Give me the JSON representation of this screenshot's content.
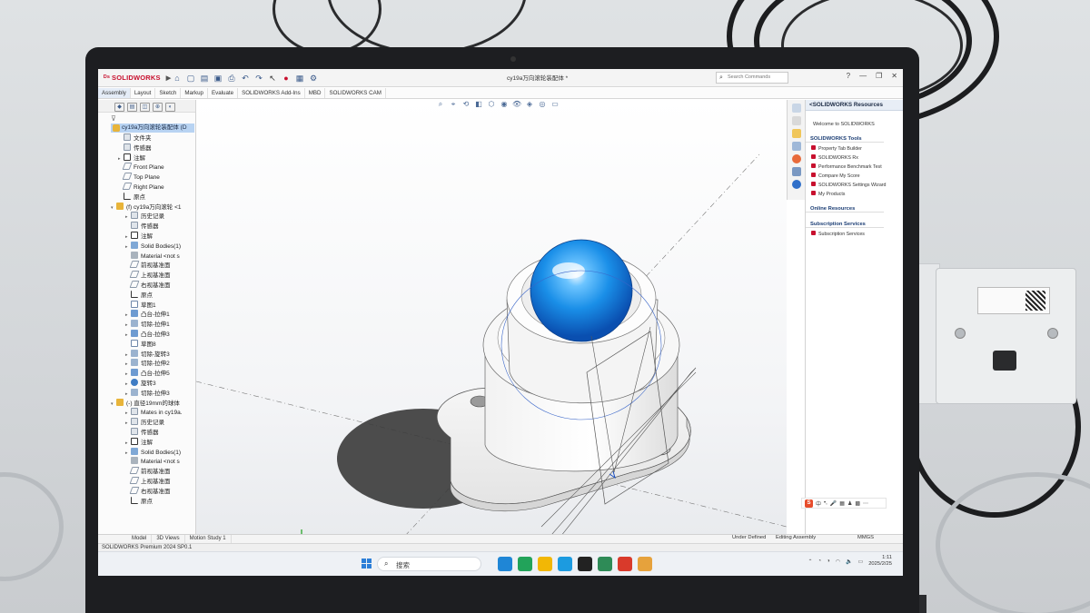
{
  "app": {
    "brand": "SOLIDWORKS",
    "document_title": "cy19a万向滚轮装配体 *",
    "search_placeholder": "Search Commands",
    "window_controls": [
      "?",
      "—",
      "❐",
      "✕"
    ]
  },
  "command_tabs": [
    {
      "label": "Assembly",
      "active": true
    },
    {
      "label": "Layout",
      "active": false
    },
    {
      "label": "Sketch",
      "active": false
    },
    {
      "label": "Markup",
      "active": false
    },
    {
      "label": "Evaluate",
      "active": false
    },
    {
      "label": "SOLIDWORKS Add-Ins",
      "active": false
    },
    {
      "label": "MBD",
      "active": false
    },
    {
      "label": "SOLIDWORKS CAM",
      "active": false
    }
  ],
  "feature_tree": {
    "root": "cy19a万向滚轮装配体 (D",
    "items": [
      {
        "label": "文件夹",
        "icon": "folder-icon",
        "indent": 1,
        "expander": "",
        "kind": "gen"
      },
      {
        "label": "传感器",
        "icon": "sensor-icon",
        "indent": 1,
        "expander": "",
        "kind": "gen"
      },
      {
        "label": "注解",
        "icon": "annotation-icon",
        "indent": 1,
        "expander": "▸",
        "kind": "ann"
      },
      {
        "label": "Front Plane",
        "icon": "plane-icon",
        "indent": 1,
        "expander": "",
        "kind": "plane"
      },
      {
        "label": "Top Plane",
        "icon": "plane-icon",
        "indent": 1,
        "expander": "",
        "kind": "plane"
      },
      {
        "label": "Right Plane",
        "icon": "plane-icon",
        "indent": 1,
        "expander": "",
        "kind": "plane"
      },
      {
        "label": "原点",
        "icon": "origin-icon",
        "indent": 1,
        "expander": "",
        "kind": "origin"
      },
      {
        "label": "(f) cy19a万向滚轮 <1",
        "icon": "part-icon",
        "indent": 0,
        "expander": "▾",
        "kind": "asm"
      },
      {
        "label": "历史记录",
        "icon": "history-icon",
        "indent": 2,
        "expander": "▸",
        "kind": "gen"
      },
      {
        "label": "传感器",
        "icon": "sensor-icon",
        "indent": 2,
        "expander": "",
        "kind": "gen"
      },
      {
        "label": "注解",
        "icon": "annotation-icon",
        "indent": 2,
        "expander": "▸",
        "kind": "ann"
      },
      {
        "label": "Solid Bodies(1)",
        "icon": "solid-bodies-icon",
        "indent": 2,
        "expander": "▸",
        "kind": "body"
      },
      {
        "label": "Material <not s",
        "icon": "material-icon",
        "indent": 2,
        "expander": "",
        "kind": "mat"
      },
      {
        "label": "前视基准面",
        "icon": "plane-icon",
        "indent": 2,
        "expander": "",
        "kind": "plane"
      },
      {
        "label": "上视基准面",
        "icon": "plane-icon",
        "indent": 2,
        "expander": "",
        "kind": "plane"
      },
      {
        "label": "右视基准面",
        "icon": "plane-icon",
        "indent": 2,
        "expander": "",
        "kind": "plane"
      },
      {
        "label": "原点",
        "icon": "origin-icon",
        "indent": 2,
        "expander": "",
        "kind": "origin"
      },
      {
        "label": "草图1",
        "icon": "sketch-icon",
        "indent": 2,
        "expander": "",
        "kind": "sketch"
      },
      {
        "label": "凸台-拉伸1",
        "icon": "extrude-icon",
        "indent": 2,
        "expander": "▸",
        "kind": "feat"
      },
      {
        "label": "切除-拉伸1",
        "icon": "cut-extrude-icon",
        "indent": 2,
        "expander": "▸",
        "kind": "cut"
      },
      {
        "label": "凸台-拉伸3",
        "icon": "extrude-icon",
        "indent": 2,
        "expander": "▸",
        "kind": "feat"
      },
      {
        "label": "草图8",
        "icon": "sketch-icon",
        "indent": 2,
        "expander": "",
        "kind": "sketch"
      },
      {
        "label": "切除-旋转3",
        "icon": "cut-revolve-icon",
        "indent": 2,
        "expander": "▸",
        "kind": "cut"
      },
      {
        "label": "切除-拉伸2",
        "icon": "cut-extrude-icon",
        "indent": 2,
        "expander": "▸",
        "kind": "cut"
      },
      {
        "label": "凸台-拉伸5",
        "icon": "extrude-icon",
        "indent": 2,
        "expander": "▸",
        "kind": "feat"
      },
      {
        "label": "旋转3",
        "icon": "revolve-icon",
        "indent": 2,
        "expander": "▸",
        "kind": "rev"
      },
      {
        "label": "切除-拉伸3",
        "icon": "cut-extrude-icon",
        "indent": 2,
        "expander": "▸",
        "kind": "cut"
      },
      {
        "label": "(-) 直径19mm的球体",
        "icon": "part-icon",
        "indent": 0,
        "expander": "▾",
        "kind": "asm"
      },
      {
        "label": "Mates in cy19a.",
        "icon": "mates-icon",
        "indent": 2,
        "expander": "▸",
        "kind": "gen"
      },
      {
        "label": "历史记录",
        "icon": "history-icon",
        "indent": 2,
        "expander": "▸",
        "kind": "gen"
      },
      {
        "label": "传感器",
        "icon": "sensor-icon",
        "indent": 2,
        "expander": "",
        "kind": "gen"
      },
      {
        "label": "注解",
        "icon": "annotation-icon",
        "indent": 2,
        "expander": "▸",
        "kind": "ann"
      },
      {
        "label": "Solid Bodies(1)",
        "icon": "solid-bodies-icon",
        "indent": 2,
        "expander": "▸",
        "kind": "body"
      },
      {
        "label": "Material <not s",
        "icon": "material-icon",
        "indent": 2,
        "expander": "",
        "kind": "mat"
      },
      {
        "label": "前视基准面",
        "icon": "plane-icon",
        "indent": 2,
        "expander": "",
        "kind": "plane"
      },
      {
        "label": "上视基准面",
        "icon": "plane-icon",
        "indent": 2,
        "expander": "",
        "kind": "plane"
      },
      {
        "label": "右视基准面",
        "icon": "plane-icon",
        "indent": 2,
        "expander": "",
        "kind": "plane"
      },
      {
        "label": "原点",
        "icon": "origin-icon",
        "indent": 2,
        "expander": "",
        "kind": "origin"
      }
    ]
  },
  "task_pane": {
    "header": "SOLIDWORKS Resources",
    "welcome": "Welcome to SOLIDWORKS",
    "sections": [
      {
        "title": "SOLIDWORKS Tools",
        "items": [
          "Property Tab Builder",
          "SOLIDWORKS Rx",
          "Performance Benchmark Test",
          "Compare My Score",
          "SOLIDWORKS Settings Wizard",
          "My Products"
        ]
      },
      {
        "title": "Online Resources",
        "items": []
      },
      {
        "title": "Subscription Services",
        "items": [
          "Subscription Services"
        ]
      }
    ]
  },
  "ime_bar": {
    "badge": "S",
    "mode": "中"
  },
  "model_tabs": [
    "Model",
    "3D Views",
    "Motion Study 1"
  ],
  "status_bar": {
    "product": "SOLIDWORKS Premium 2024 SP0.1",
    "state": "Under Defined",
    "mode": "Editing Assembly",
    "units": "MMGS"
  },
  "taskbar": {
    "search_label": "搜索",
    "time": "1:11",
    "date": "2025/2/25",
    "app_colors": [
      "#1f86d6",
      "#22a35a",
      "#f2b705",
      "#1c9be0",
      "#222222",
      "#2e8b57",
      "#d93a2b",
      "#e6a23c"
    ]
  },
  "colors": {
    "brand_red": "#c8102e",
    "ball_blue": "#1a8fe8",
    "selection_blue": "#b8d3f2"
  }
}
